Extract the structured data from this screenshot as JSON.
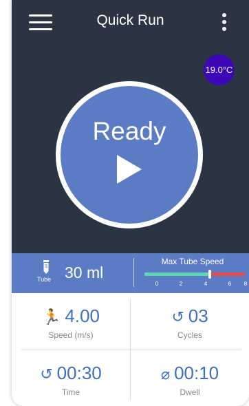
{
  "header": {
    "title": "Quick Run",
    "menu_icon": "hamburger-icon",
    "more_icon": "kebab-icon"
  },
  "temperature": "19.0°C",
  "main": {
    "status": "Ready",
    "play_icon": "play-icon"
  },
  "info": {
    "tube_label": "Tube",
    "volume": "30 ml",
    "max_speed_label": "Max Tube Speed",
    "scale": [
      "0",
      "2",
      "4",
      "6",
      "8"
    ],
    "max_speed_value": 5.2,
    "max_speed_range": [
      0,
      8
    ]
  },
  "stats": {
    "speed": {
      "value": "4.00",
      "label": "Speed (m/s)",
      "icon": "runner-icon"
    },
    "cycles": {
      "value": "03",
      "label": "Cycles",
      "icon": "repeat-icon"
    },
    "time": {
      "value": "00:30",
      "label": "Time",
      "icon": "repeat-icon"
    },
    "dwell": {
      "value": "00:10",
      "label": "Dwell",
      "icon": "stopwatch-icon"
    }
  },
  "colors": {
    "dark_bg": "#2b3442",
    "accent_blue": "#5b7bc4",
    "temp_badge": "#3d07b7",
    "value_blue": "#3c6ec6",
    "slider_green": "#5cd9b3",
    "slider_red": "#e54b4b"
  }
}
